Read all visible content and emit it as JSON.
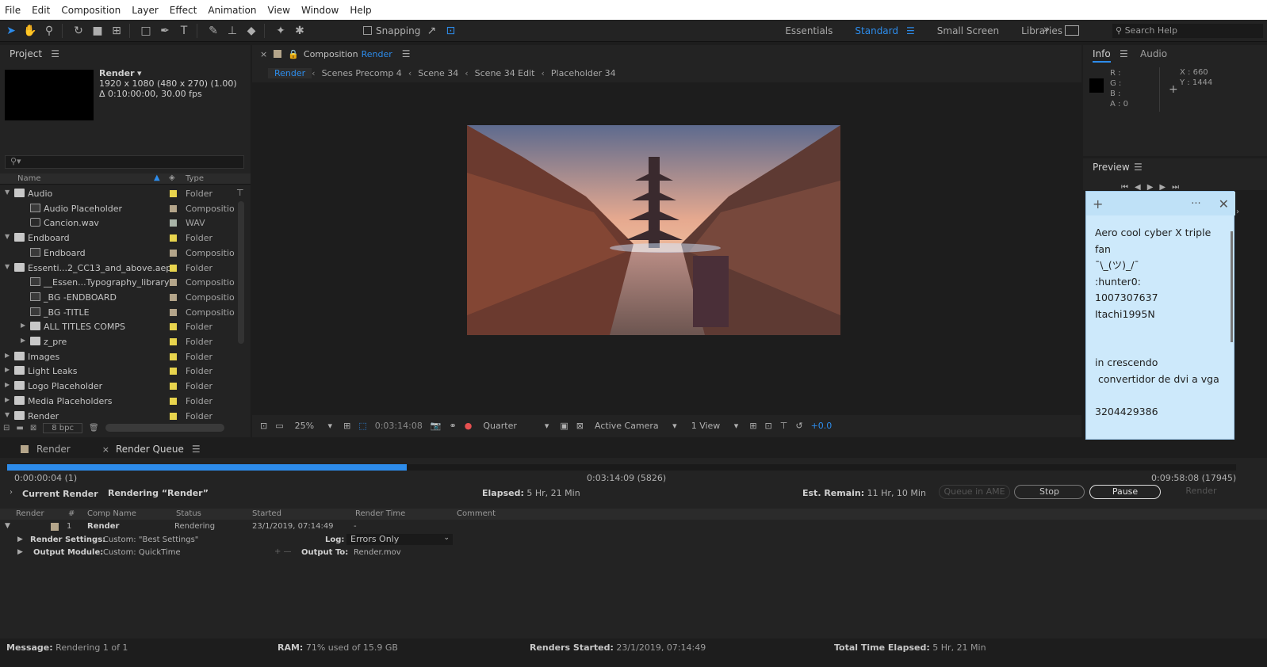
{
  "menu": [
    "File",
    "Edit",
    "Composition",
    "Layer",
    "Effect",
    "Animation",
    "View",
    "Window",
    "Help"
  ],
  "toolbar": {
    "snapping": "Snapping",
    "workspaces": [
      "Essentials",
      "Standard",
      "Small Screen",
      "Libraries"
    ],
    "active_workspace": "Standard",
    "search_placeholder": "Search Help"
  },
  "project": {
    "title": "Project",
    "comp_name": "Render",
    "comp_res": "1920 x 1080  (480 x 270) (1.00)",
    "comp_dur": "Δ 0:10:00:00, 30.00 fps",
    "col_name": "Name",
    "col_type": "Type",
    "bpc": "8 bpc",
    "items": [
      {
        "name": "Audio",
        "type": "Folder",
        "kind": "folder",
        "level": 0,
        "open": true,
        "swatch": "#e8d44d"
      },
      {
        "name": "Audio Placeholder",
        "type": "Compositio",
        "kind": "comp",
        "level": 1,
        "swatch": "#b4a58a"
      },
      {
        "name": "Cancion.wav",
        "type": "WAV",
        "kind": "wav",
        "level": 1,
        "swatch": "#a9b4a8"
      },
      {
        "name": "Endboard",
        "type": "Folder",
        "kind": "folder",
        "level": 0,
        "open": true,
        "swatch": "#e8d44d"
      },
      {
        "name": "Endboard",
        "type": "Compositio",
        "kind": "comp",
        "level": 1,
        "swatch": "#b4a58a"
      },
      {
        "name": "Essenti...2_CC13_and_above.aep",
        "type": "Folder",
        "kind": "folder",
        "level": 0,
        "open": true,
        "swatch": "#e8d44d"
      },
      {
        "name": "__Essen...Typography_library",
        "type": "Compositio",
        "kind": "comp",
        "level": 1,
        "swatch": "#b4a58a"
      },
      {
        "name": "_BG -ENDBOARD",
        "type": "Compositio",
        "kind": "comp",
        "level": 1,
        "swatch": "#b4a58a"
      },
      {
        "name": "_BG -TITLE",
        "type": "Compositio",
        "kind": "comp",
        "level": 1,
        "swatch": "#b4a58a"
      },
      {
        "name": "ALL TITLES COMPS",
        "type": "Folder",
        "kind": "folder",
        "level": 1,
        "open": false,
        "swatch": "#e8d44d"
      },
      {
        "name": "z_pre",
        "type": "Folder",
        "kind": "folder",
        "level": 1,
        "open": false,
        "swatch": "#e8d44d"
      },
      {
        "name": "Images",
        "type": "Folder",
        "kind": "folder",
        "level": 0,
        "open": false,
        "swatch": "#e8d44d"
      },
      {
        "name": "Light Leaks",
        "type": "Folder",
        "kind": "folder",
        "level": 0,
        "open": false,
        "swatch": "#e8d44d"
      },
      {
        "name": "Logo Placeholder",
        "type": "Folder",
        "kind": "folder",
        "level": 0,
        "open": false,
        "swatch": "#e8d44d"
      },
      {
        "name": "Media Placeholders",
        "type": "Folder",
        "kind": "folder",
        "level": 0,
        "open": false,
        "swatch": "#e8d44d"
      },
      {
        "name": "Render",
        "type": "Folder",
        "kind": "folder",
        "level": 0,
        "open": true,
        "swatch": "#e8d44d"
      }
    ]
  },
  "composition": {
    "tab_prefix": "Composition",
    "tab_name": "Render",
    "breadcrumb": [
      "Render",
      "Scenes Precomp 4",
      "Scene 34",
      "Scene 34 Edit",
      "Placeholder 34"
    ],
    "zoom": "25%",
    "timecode": "0:03:14:08",
    "quality": "Quarter",
    "camera": "Active Camera",
    "views": "1 View",
    "exposure": "+0.0"
  },
  "info": {
    "tab1": "Info",
    "tab2": "Audio",
    "r": "R :",
    "g": "G :",
    "b": "B :",
    "a": "A : 0",
    "x": "X : 660",
    "y": "Y : 1444"
  },
  "preview": {
    "title": "Preview"
  },
  "sticky": {
    "text": "Aero cool cyber X triple fan\n¯\\_(ツ)_/¯\n:hunter0:\n1007307637\nItachi1995N\n\n\nin crescendo\n convertidor de dvi a vga\n\n3204429386"
  },
  "render_queue": {
    "tab_render": "Render",
    "tab_queue": "Render Queue",
    "progress": 0.325,
    "t_start": "0:00:00:04 (1)",
    "t_current": "0:03:14:09 (5826)",
    "t_end": "0:09:58:08 (17945)",
    "current_render_label": "Current Render",
    "rendering": "Rendering “Render”",
    "elapsed_label": "Elapsed:",
    "elapsed": "5 Hr, 21 Min",
    "remain_label": "Est. Remain:",
    "remain": "11 Hr, 10 Min",
    "btn_ame": "Queue in AME",
    "btn_stop": "Stop",
    "btn_pause": "Pause",
    "btn_render": "Render",
    "cols": [
      "Render",
      "#",
      "Comp Name",
      "Status",
      "Started",
      "Render Time",
      "Comment"
    ],
    "row": {
      "num": "1",
      "comp": "Render",
      "status": "Rendering",
      "started": "23/1/2019, 07:14:49",
      "time": "-"
    },
    "settings_label": "Render Settings:",
    "settings_val": "Custom: \"Best Settings\"",
    "log_label": "Log:",
    "log_val": "Errors Only",
    "output_label": "Output Module:",
    "output_val": "Custom: QuickTime",
    "output_to_label": "Output To:",
    "output_to_val": "Render.mov"
  },
  "status": {
    "msg_label": "Message:",
    "msg": "Rendering 1 of 1",
    "ram_label": "RAM:",
    "ram": "71% used of 15.9 GB",
    "started_label": "Renders Started:",
    "started": "23/1/2019, 07:14:49",
    "total_label": "Total Time Elapsed:",
    "total": "5 Hr, 21 Min"
  }
}
